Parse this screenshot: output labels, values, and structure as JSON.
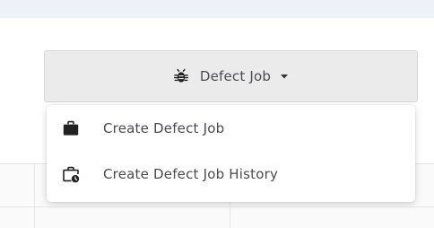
{
  "dropdown": {
    "icon": "bug-icon",
    "label": "Defect Job",
    "caret_icon": "caret-down-icon"
  },
  "menu": {
    "items": [
      {
        "icon": "briefcase-icon",
        "label": "Create Defect Job"
      },
      {
        "icon": "briefcase-history-icon",
        "label": "Create Defect Job History"
      }
    ]
  },
  "colors": {
    "button_bg": "#ebebeb",
    "menu_bg": "#ffffff",
    "text": "#4a4a52",
    "icon": "#222222"
  }
}
